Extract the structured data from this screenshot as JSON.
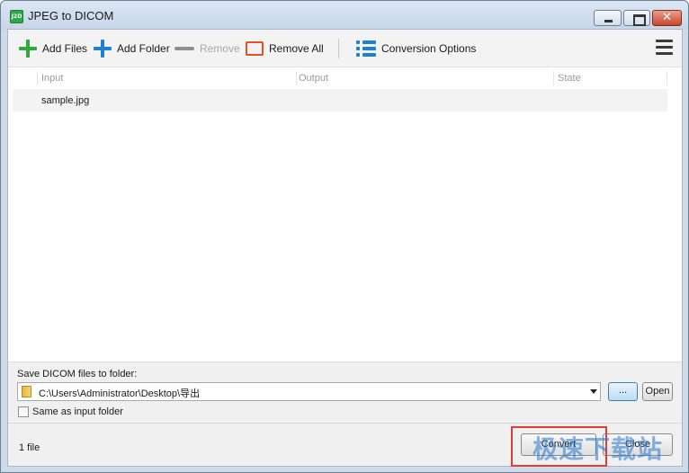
{
  "window": {
    "title": "JPEG to DICOM",
    "app_icon_text": "J2D",
    "close_glyph": "✕"
  },
  "toolbar": {
    "add_files": "Add Files",
    "add_folder": "Add Folder",
    "remove": "Remove",
    "remove_all": "Remove All",
    "conversion_options": "Conversion Options"
  },
  "file_list": {
    "columns": [
      "Input",
      "Output",
      "State"
    ],
    "rows": [
      {
        "input": "sample.jpg",
        "output": "",
        "state": ""
      }
    ]
  },
  "output": {
    "save_label": "Save DICOM files to folder:",
    "path": "C:\\Users\\Administrator\\Desktop\\导出",
    "browse_label": "...",
    "open_label": "Open",
    "same_as_input_label": "Same as input folder",
    "same_as_input_checked": false
  },
  "status": {
    "file_count": "1 file",
    "convert_label": "Convert",
    "close_label": "Close"
  },
  "watermark": "极速下载站",
  "colors": {
    "add_green": "#2eaa3c",
    "accent_blue": "#1e7fd8",
    "remove_all_orange": "#e2541f",
    "highlight_red": "#e03c3c"
  }
}
